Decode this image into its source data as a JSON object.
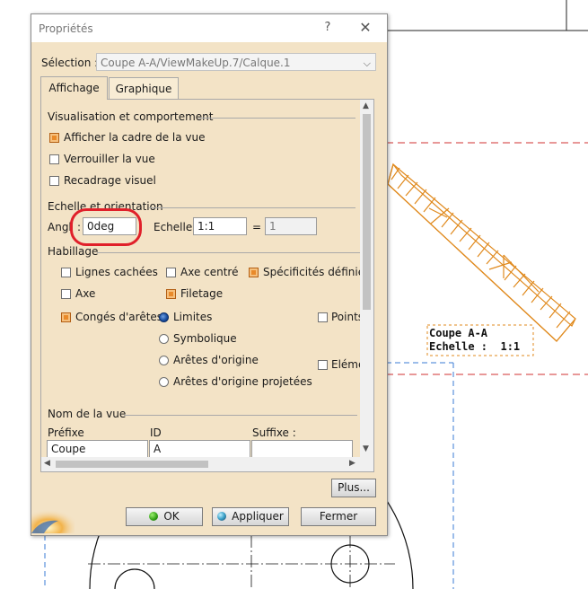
{
  "dialog": {
    "title": "Propriétés",
    "help_glyph": "?",
    "close_glyph": "✕",
    "selection_label": "Sélection :",
    "selection_value": "Coupe A-A/ViewMakeUp.7/Calque.1",
    "tabs": [
      {
        "label": "Affichage",
        "active": true
      },
      {
        "label": "Graphique",
        "active": false
      }
    ],
    "visualisation": {
      "title": "Visualisation et comportement",
      "options": [
        {
          "label": "Afficher la cadre de la vue",
          "checked": true
        },
        {
          "label": "Verrouiller la vue",
          "checked": false
        },
        {
          "label": "Recadrage visuel",
          "checked": false
        }
      ]
    },
    "echelle": {
      "title": "Echelle et orientation",
      "angle_label": "Angl",
      "angle_colon": ":",
      "angle_value": "0deg",
      "scale_label": "Echelle :",
      "scale_value": "1:1",
      "equals": "=",
      "scale_result": "1"
    },
    "habillage": {
      "title": "Habillage",
      "lignes_cachees": {
        "label": "Lignes cachées",
        "checked": false
      },
      "axe_centre": {
        "label": "Axe centré",
        "checked": false
      },
      "specificites": {
        "label": "Spécificités définies d",
        "checked": true
      },
      "axe": {
        "label": "Axe",
        "checked": false
      },
      "filetage": {
        "label": "Filetage",
        "checked": true
      },
      "conges": {
        "label": "Congés d'arêtes",
        "checked": true
      },
      "points": {
        "label": "Points",
        "checked": false
      },
      "elements": {
        "label": "Elémen",
        "checked": false
      },
      "radios": [
        {
          "label": "Limites",
          "selected": true
        },
        {
          "label": "Symbolique",
          "selected": false
        },
        {
          "label": "Arêtes d'origine",
          "selected": false
        },
        {
          "label": "Arêtes d'origine projetées",
          "selected": false
        }
      ]
    },
    "nom_vue": {
      "title": "Nom de la vue",
      "headers": [
        "Préfixe",
        "ID",
        "Suffixe :"
      ],
      "values": [
        "Coupe",
        "A",
        ""
      ]
    },
    "buttons": {
      "plus": "Plus...",
      "ok": "OK",
      "apply": "Appliquer",
      "close": "Fermer"
    }
  },
  "drawing": {
    "view_label_line1": "Coupe A-A",
    "view_label_line2": "Echelle :  1:1"
  },
  "colors": {
    "dialog_bg": "#f3e3c6",
    "hatch_orange": "#e08a1e",
    "annotation_red": "#e0202a",
    "cut_line_red": "#d03030",
    "frame_blue": "#3a7bd5"
  }
}
